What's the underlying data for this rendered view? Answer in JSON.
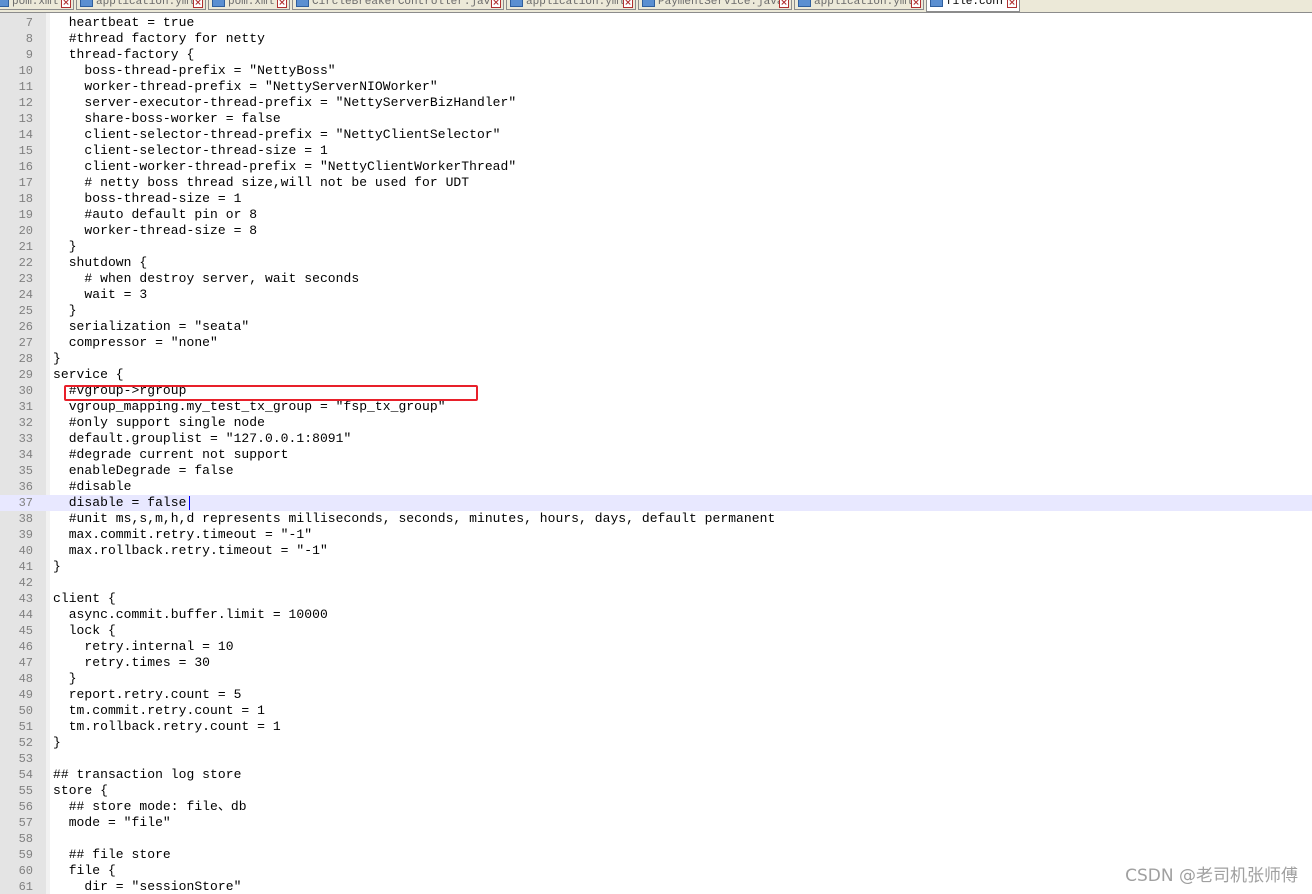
{
  "tabs": [
    {
      "label": "pom.xml",
      "active": false
    },
    {
      "label": "application.yml",
      "active": false
    },
    {
      "label": "pom.xml",
      "active": false
    },
    {
      "label": "CircleBreakerController.java",
      "active": false
    },
    {
      "label": "application.yml",
      "active": false
    },
    {
      "label": "PaymentService.java",
      "active": false
    },
    {
      "label": "application.yml",
      "active": false
    },
    {
      "label": "file.conf",
      "active": true
    }
  ],
  "tab_close_glyph": "×",
  "editor": {
    "current_line": 37,
    "highlighted_line": 31,
    "highlight_color": "#e8202a",
    "lines": [
      {
        "n": "7",
        "text": "  heartbeat = true"
      },
      {
        "n": "8",
        "text": "  #thread factory for netty"
      },
      {
        "n": "9",
        "text": "  thread-factory {"
      },
      {
        "n": "10",
        "text": "    boss-thread-prefix = \"NettyBoss\""
      },
      {
        "n": "11",
        "text": "    worker-thread-prefix = \"NettyServerNIOWorker\""
      },
      {
        "n": "12",
        "text": "    server-executor-thread-prefix = \"NettyServerBizHandler\""
      },
      {
        "n": "13",
        "text": "    share-boss-worker = false"
      },
      {
        "n": "14",
        "text": "    client-selector-thread-prefix = \"NettyClientSelector\""
      },
      {
        "n": "15",
        "text": "    client-selector-thread-size = 1"
      },
      {
        "n": "16",
        "text": "    client-worker-thread-prefix = \"NettyClientWorkerThread\""
      },
      {
        "n": "17",
        "text": "    # netty boss thread size,will not be used for UDT"
      },
      {
        "n": "18",
        "text": "    boss-thread-size = 1"
      },
      {
        "n": "19",
        "text": "    #auto default pin or 8"
      },
      {
        "n": "20",
        "text": "    worker-thread-size = 8"
      },
      {
        "n": "21",
        "text": "  }"
      },
      {
        "n": "22",
        "text": "  shutdown {"
      },
      {
        "n": "23",
        "text": "    # when destroy server, wait seconds"
      },
      {
        "n": "24",
        "text": "    wait = 3"
      },
      {
        "n": "25",
        "text": "  }"
      },
      {
        "n": "26",
        "text": "  serialization = \"seata\""
      },
      {
        "n": "27",
        "text": "  compressor = \"none\""
      },
      {
        "n": "28",
        "text": "}"
      },
      {
        "n": "29",
        "text": "service {"
      },
      {
        "n": "30",
        "text": "  #vgroup->rgroup"
      },
      {
        "n": "31",
        "text": "  vgroup_mapping.my_test_tx_group = \"fsp_tx_group\""
      },
      {
        "n": "32",
        "text": "  #only support single node"
      },
      {
        "n": "33",
        "text": "  default.grouplist = \"127.0.0.1:8091\""
      },
      {
        "n": "34",
        "text": "  #degrade current not support"
      },
      {
        "n": "35",
        "text": "  enableDegrade = false"
      },
      {
        "n": "36",
        "text": "  #disable"
      },
      {
        "n": "37",
        "text": "  disable = false"
      },
      {
        "n": "38",
        "text": "  #unit ms,s,m,h,d represents milliseconds, seconds, minutes, hours, days, default permanent"
      },
      {
        "n": "39",
        "text": "  max.commit.retry.timeout = \"-1\""
      },
      {
        "n": "40",
        "text": "  max.rollback.retry.timeout = \"-1\""
      },
      {
        "n": "41",
        "text": "}"
      },
      {
        "n": "42",
        "text": ""
      },
      {
        "n": "43",
        "text": "client {"
      },
      {
        "n": "44",
        "text": "  async.commit.buffer.limit = 10000"
      },
      {
        "n": "45",
        "text": "  lock {"
      },
      {
        "n": "46",
        "text": "    retry.internal = 10"
      },
      {
        "n": "47",
        "text": "    retry.times = 30"
      },
      {
        "n": "48",
        "text": "  }"
      },
      {
        "n": "49",
        "text": "  report.retry.count = 5"
      },
      {
        "n": "50",
        "text": "  tm.commit.retry.count = 1"
      },
      {
        "n": "51",
        "text": "  tm.rollback.retry.count = 1"
      },
      {
        "n": "52",
        "text": "}"
      },
      {
        "n": "53",
        "text": ""
      },
      {
        "n": "54",
        "text": "## transaction log store"
      },
      {
        "n": "55",
        "text": "store {"
      },
      {
        "n": "56",
        "text": "  ## store mode: file、db"
      },
      {
        "n": "57",
        "text": "  mode = \"file\""
      },
      {
        "n": "58",
        "text": ""
      },
      {
        "n": "59",
        "text": "  ## file store"
      },
      {
        "n": "60",
        "text": "  file {"
      },
      {
        "n": "61",
        "text": "    dir = \"sessionStore\""
      }
    ]
  },
  "watermark": "CSDN @老司机张师傅"
}
